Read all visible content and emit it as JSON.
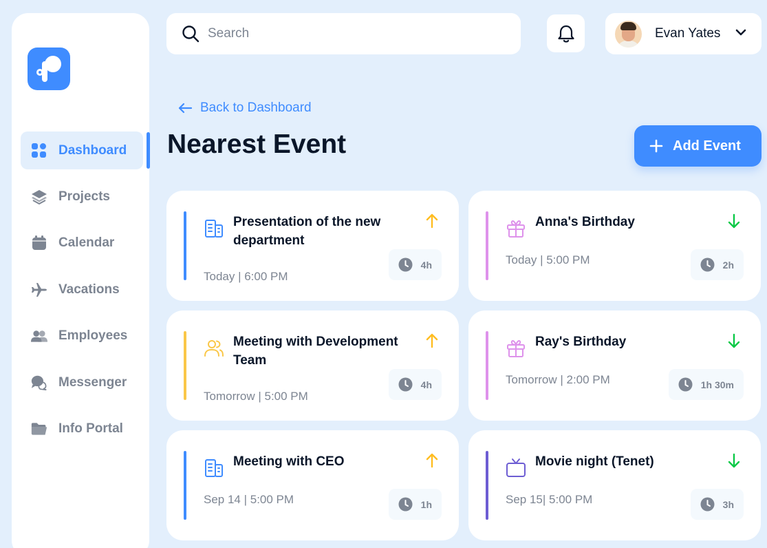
{
  "search": {
    "placeholder": "Search"
  },
  "user": {
    "name": "Evan Yates"
  },
  "sidebar": {
    "items": [
      {
        "label": "Dashboard",
        "icon": "dashboard-icon",
        "active": true
      },
      {
        "label": "Projects",
        "icon": "layers-icon"
      },
      {
        "label": "Calendar",
        "icon": "calendar-icon"
      },
      {
        "label": "Vacations",
        "icon": "plane-icon"
      },
      {
        "label": "Employees",
        "icon": "users-icon"
      },
      {
        "label": "Messenger",
        "icon": "chat-icon"
      },
      {
        "label": "Info Portal",
        "icon": "folder-icon"
      }
    ]
  },
  "page": {
    "back_label": "Back to Dashboard",
    "title": "Nearest Event",
    "add_button": "Add Event"
  },
  "colors": {
    "accent": "#3f8cff",
    "high_priority": "#ffbd21",
    "low_priority": "#0ac947",
    "birthday": "#de92eb",
    "movie": "#6d5dd3",
    "meeting_team": "#fac748"
  },
  "events": [
    {
      "title": "Presentation of the new department",
      "date": "Today | 6:00 PM",
      "duration": "4h",
      "priority": "up",
      "icon": "office-building-icon",
      "color": "#3f8cff"
    },
    {
      "title": "Anna's Birthday",
      "date": "Today | 5:00 PM",
      "duration": "2h",
      "priority": "down",
      "icon": "gift-icon",
      "color": "#de92eb"
    },
    {
      "title": "Meeting with Development Team",
      "date": "Tomorrow | 5:00 PM",
      "duration": "4h",
      "priority": "up",
      "icon": "team-icon",
      "color": "#fac748"
    },
    {
      "title": "Ray's Birthday",
      "date": "Tomorrow | 2:00 PM",
      "duration": "1h 30m",
      "priority": "down",
      "icon": "gift-icon",
      "color": "#de92eb"
    },
    {
      "title": "Meeting with CEO",
      "date": "Sep 14 | 5:00 PM",
      "duration": "1h",
      "priority": "up",
      "icon": "office-building-icon",
      "color": "#3f8cff"
    },
    {
      "title": "Movie night (Tenet)",
      "date": "Sep 15| 5:00 PM",
      "duration": "3h",
      "priority": "down",
      "icon": "tv-icon",
      "color": "#6d5dd3"
    }
  ]
}
